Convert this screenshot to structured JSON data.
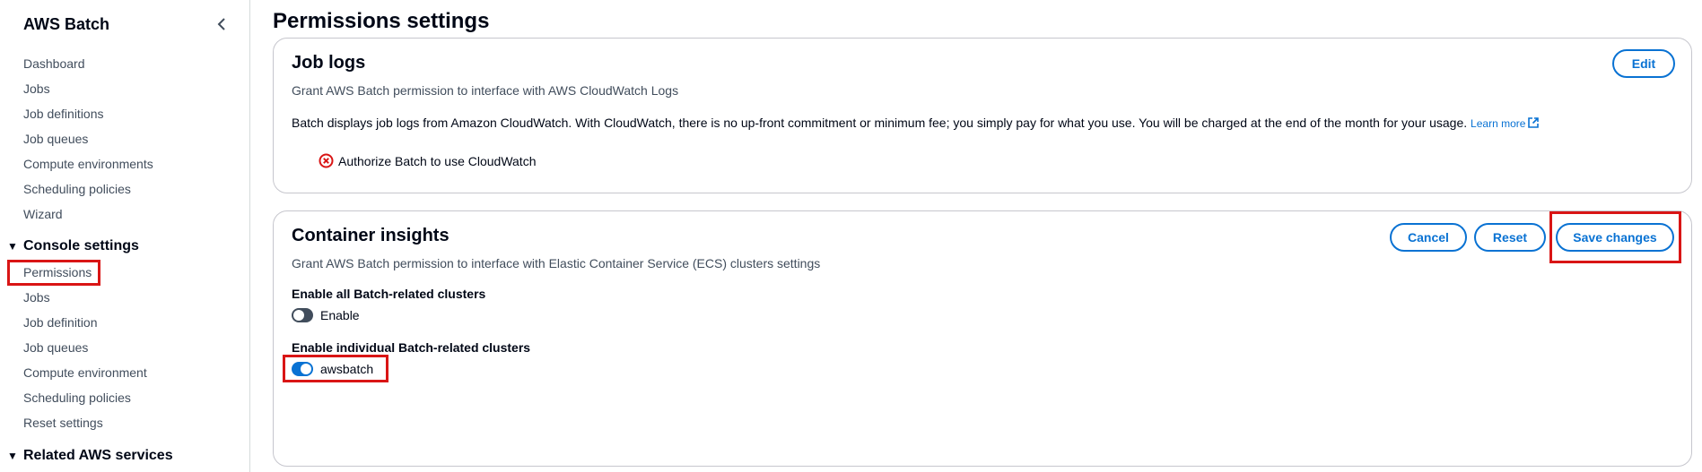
{
  "sidebar": {
    "title": "AWS Batch",
    "collapse_icon": "chevron-left-icon",
    "items": [
      {
        "label": "Dashboard"
      },
      {
        "label": "Jobs"
      },
      {
        "label": "Job definitions"
      },
      {
        "label": "Job queues"
      },
      {
        "label": "Compute environments"
      },
      {
        "label": "Scheduling policies"
      },
      {
        "label": "Wizard"
      }
    ],
    "console_settings": {
      "label": "Console settings",
      "items": [
        {
          "label": "Permissions"
        },
        {
          "label": "Jobs"
        },
        {
          "label": "Job definition"
        },
        {
          "label": "Job queues"
        },
        {
          "label": "Compute environment"
        },
        {
          "label": "Scheduling policies"
        },
        {
          "label": "Reset settings"
        }
      ]
    },
    "related": {
      "label": "Related AWS services"
    }
  },
  "main": {
    "title": "Permissions settings",
    "job_logs": {
      "title": "Job logs",
      "edit_label": "Edit",
      "description": "Grant AWS Batch permission to interface with AWS CloudWatch Logs",
      "info": "Batch displays job logs from Amazon CloudWatch. With CloudWatch, there is no up-front commitment or minimum fee; you simply pay for what you use. You will be charged at the end of the month for your usage.",
      "learn_more": "Learn more",
      "status": "Authorize Batch to use CloudWatch",
      "status_icon": "error-icon"
    },
    "container_insights": {
      "title": "Container insights",
      "description": "Grant AWS Batch permission to interface with Elastic Container Service (ECS) clusters settings",
      "cancel_label": "Cancel",
      "reset_label": "Reset",
      "save_label": "Save changes",
      "all_clusters_label": "Enable all Batch-related clusters",
      "all_clusters_toggle_label": "Enable",
      "all_clusters_enabled": false,
      "individual_label": "Enable individual Batch-related clusters",
      "individual_toggle_label": "awsbatch",
      "individual_enabled": true
    }
  },
  "colors": {
    "accent": "#0972d3",
    "highlight": "#d91515",
    "error": "#d91515"
  }
}
